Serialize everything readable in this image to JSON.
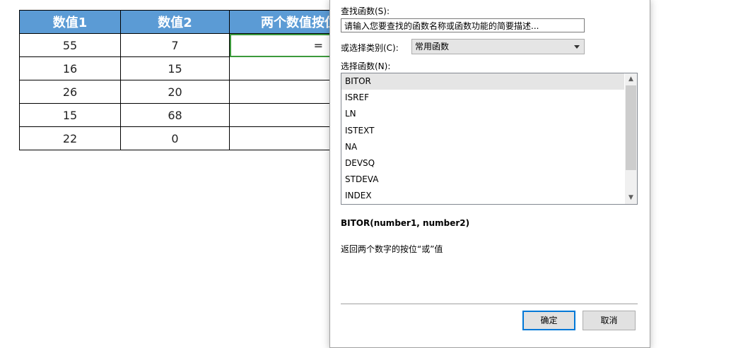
{
  "sheet": {
    "headers": [
      "数值1",
      "数值2",
      "两个数值按位"
    ],
    "rows": [
      [
        "55",
        "7",
        "="
      ],
      [
        "16",
        "15",
        ""
      ],
      [
        "26",
        "20",
        ""
      ],
      [
        "15",
        "68",
        ""
      ],
      [
        "22",
        "0",
        ""
      ]
    ]
  },
  "dialog": {
    "search_label": "查找函数(S):",
    "search_value": "请输入您要查找的函数名称或函数功能的简要描述...",
    "category_label": "或选择类别(C):",
    "category_value": "常用函数",
    "function_label": "选择函数(N):",
    "functions": [
      "BITOR",
      "ISREF",
      "LN",
      "ISTEXT",
      "NA",
      "DEVSQ",
      "STDEVA",
      "INDEX"
    ],
    "signature": "BITOR(number1, number2)",
    "description": "返回两个数字的按位“或”值",
    "ok_label": "确定",
    "cancel_label": "取消"
  },
  "colors": {
    "header_bg": "#5b9bd5",
    "active_cell_border": "#3c9a3c",
    "ok_border": "#0078d7"
  }
}
